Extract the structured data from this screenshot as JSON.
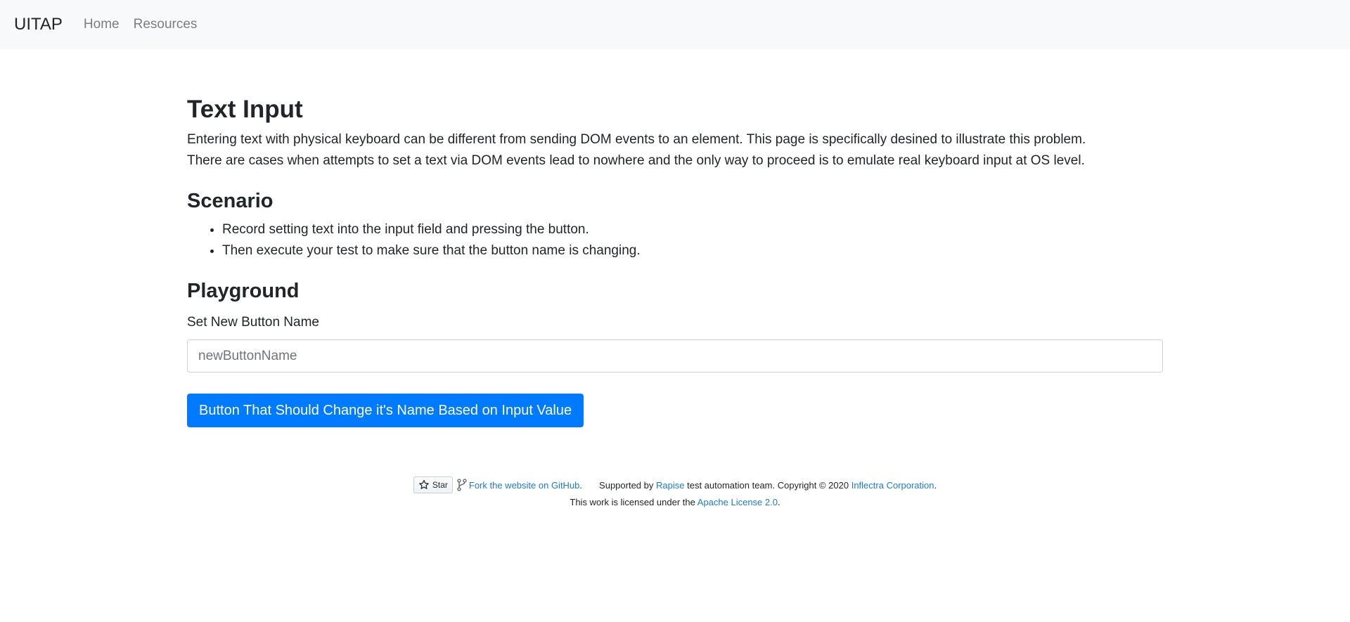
{
  "nav": {
    "brand": "UITAP",
    "links": [
      "Home",
      "Resources"
    ]
  },
  "main": {
    "title": "Text Input",
    "description": [
      "Entering text with physical keyboard can be different from sending DOM events to an element. This page is specifically desined to illustrate this problem.",
      "There are cases when attempts to set a text via DOM events lead to nowhere and the only way to proceed is to emulate real keyboard input at OS level."
    ],
    "scenario_heading": "Scenario",
    "scenario_items": [
      "Record setting text into the input field and pressing the button.",
      "Then execute your test to make sure that the button name is changing."
    ],
    "playground_heading": "Playground",
    "input_label": "Set New Button Name",
    "input_placeholder": "newButtonName",
    "input_value": "",
    "button_label": "Button That Should Change it's Name Based on Input Value",
    "button_color": "#007bff"
  },
  "footer": {
    "star_label": "Star",
    "fork_link": "Fork the website on GitHub",
    "supported_by": "Supported by",
    "rapise_link": "Rapise",
    "team_text": "test automation team. Copyright © 2020",
    "inflectra_link": "Inflectra Corporation",
    "license_text": "This work is licensed under the",
    "license_link": "Apache License 2.0",
    "link_color": "#1a7be0"
  }
}
